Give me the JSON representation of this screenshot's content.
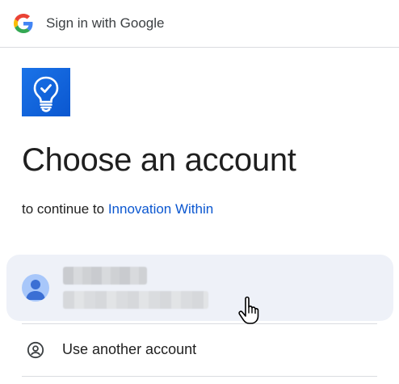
{
  "header": {
    "title": "Sign in with Google",
    "logo_icon": "google-g-icon"
  },
  "app": {
    "logo_icon": "lightbulb-check-icon",
    "name": "Innovation Within"
  },
  "page": {
    "heading": "Choose an account",
    "subtitle_prefix": "to continue to"
  },
  "accounts": [
    {
      "avatar_icon": "person-avatar-icon",
      "name": "",
      "email": "",
      "obscured": true
    }
  ],
  "actions": {
    "use_another_label": "Use another account",
    "use_another_icon": "account-circle-icon"
  },
  "colors": {
    "link": "#0b57d0",
    "card_bg": "#eef1f8",
    "logo_bg": "#1a73e8",
    "avatar": "#a8c7fa"
  }
}
